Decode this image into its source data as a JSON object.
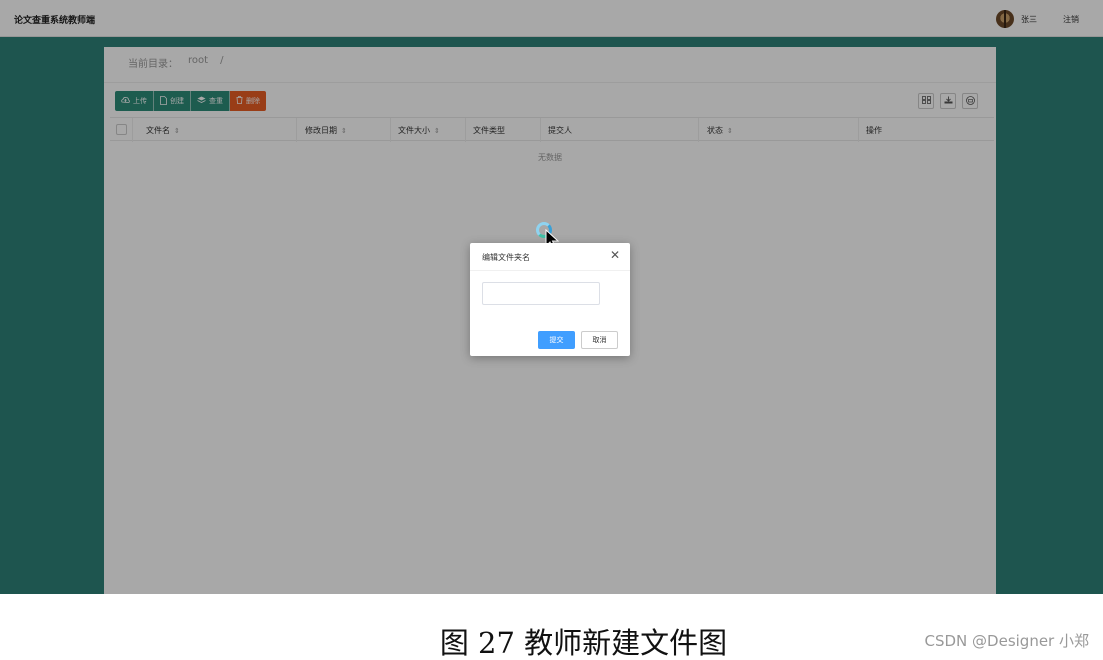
{
  "app": {
    "title": "论文查重系统教师端",
    "user_name": "张三",
    "logout_label": "注销"
  },
  "breadcrumb": {
    "label": "当前目录：",
    "path": "root",
    "separator": "/"
  },
  "toolbar": {
    "buttons": [
      {
        "label": "上传",
        "icon": "upload-icon"
      },
      {
        "label": "创建",
        "icon": "file-icon"
      },
      {
        "label": "查重",
        "icon": "stack-icon"
      },
      {
        "label": "删除",
        "icon": "trash-icon"
      }
    ],
    "right_tools": [
      "columns-icon",
      "export-icon",
      "print-icon"
    ],
    "colors": {
      "primary": "#2d8c79",
      "danger": "#e85d24"
    }
  },
  "table": {
    "columns": [
      "文件名",
      "修改日期",
      "文件大小",
      "文件类型",
      "提交人",
      "状态",
      "操作"
    ],
    "sortable": [
      true,
      true,
      true,
      false,
      false,
      true,
      false
    ],
    "empty_text": "无数据"
  },
  "dialog": {
    "title": "编辑文件夹名",
    "input_value": "",
    "submit_label": "提交",
    "cancel_label": "取消"
  },
  "caption": {
    "text": "图 27 教师新建文件图",
    "watermark": "CSDN @Designer 小郑"
  }
}
